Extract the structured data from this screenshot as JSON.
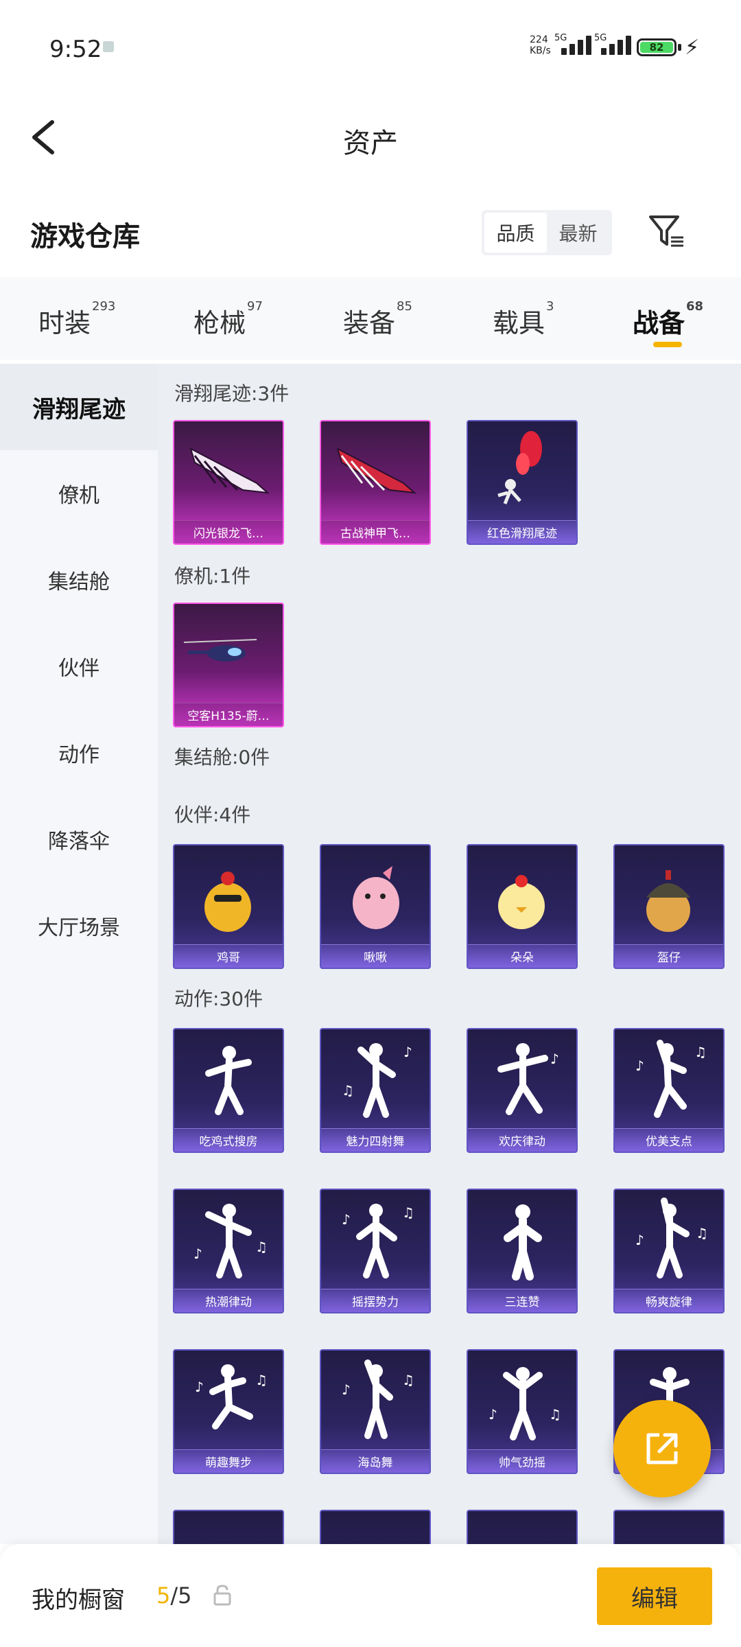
{
  "status_bar": {
    "time": "9:52",
    "net_speed_value": "224",
    "net_speed_unit": "KB/s",
    "sim1": "5G",
    "sim2": "5G",
    "battery": "82"
  },
  "header": {
    "title": "资产"
  },
  "section": {
    "title": "游戏仓库",
    "sort_options": [
      "品质",
      "最新"
    ]
  },
  "categories": [
    {
      "label": "时装",
      "count": "293"
    },
    {
      "label": "枪械",
      "count": "97"
    },
    {
      "label": "装备",
      "count": "85"
    },
    {
      "label": "载具",
      "count": "3"
    },
    {
      "label": "战备",
      "count": "68",
      "active": true
    }
  ],
  "sidebar": {
    "items": [
      "滑翔尾迹",
      "僚机",
      "集结舱",
      "伙伴",
      "动作",
      "降落伞",
      "大厅场景"
    ]
  },
  "groups": {
    "trail": {
      "title": "滑翔尾迹:3件",
      "items": [
        "闪光银龙飞…",
        "古战神甲飞…",
        "红色滑翔尾迹"
      ]
    },
    "wingman": {
      "title": "僚机:1件",
      "items": [
        "空客H135-蔚…"
      ]
    },
    "capsule": {
      "title": "集结舱:0件"
    },
    "partner": {
      "title": "伙伴:4件",
      "items": [
        "鸡哥",
        "啾啾",
        "朵朵",
        "盔仔"
      ]
    },
    "emote": {
      "title": "动作:30件",
      "items": [
        "吃鸡式搜房",
        "魅力四射舞",
        "欢庆律动",
        "优美支点",
        "热潮律动",
        "摇摆势力",
        "三连赞",
        "畅爽旋律",
        "萌趣舞步",
        "海岛舞",
        "帅气劲摇"
      ]
    }
  },
  "bottom_bar": {
    "window_label": "我的橱窗",
    "current": "5",
    "total": "/5",
    "edit_label": "编辑"
  },
  "colors": {
    "accent": "#f6b20c",
    "card_pink_border": "#ff59e8",
    "card_purple_border": "#5f55c2"
  }
}
